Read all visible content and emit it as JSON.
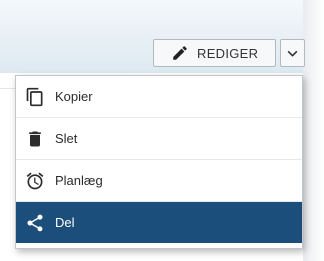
{
  "toolbar": {
    "edit_label": "REDIGER",
    "edit_icon": "pencil-icon",
    "dropdown_icon": "chevron-down-icon"
  },
  "menu": {
    "items": [
      {
        "label": "Kopier",
        "icon": "copy-icon",
        "active": false
      },
      {
        "label": "Slet",
        "icon": "trash-icon",
        "active": false
      },
      {
        "label": "Planlæg",
        "icon": "alarm-clock-icon",
        "active": false
      },
      {
        "label": "Del",
        "icon": "share-icon",
        "active": true
      }
    ]
  },
  "colors": {
    "active_background": "#1b4e7a",
    "active_text": "#ffffff",
    "text": "#2b2b2b"
  }
}
